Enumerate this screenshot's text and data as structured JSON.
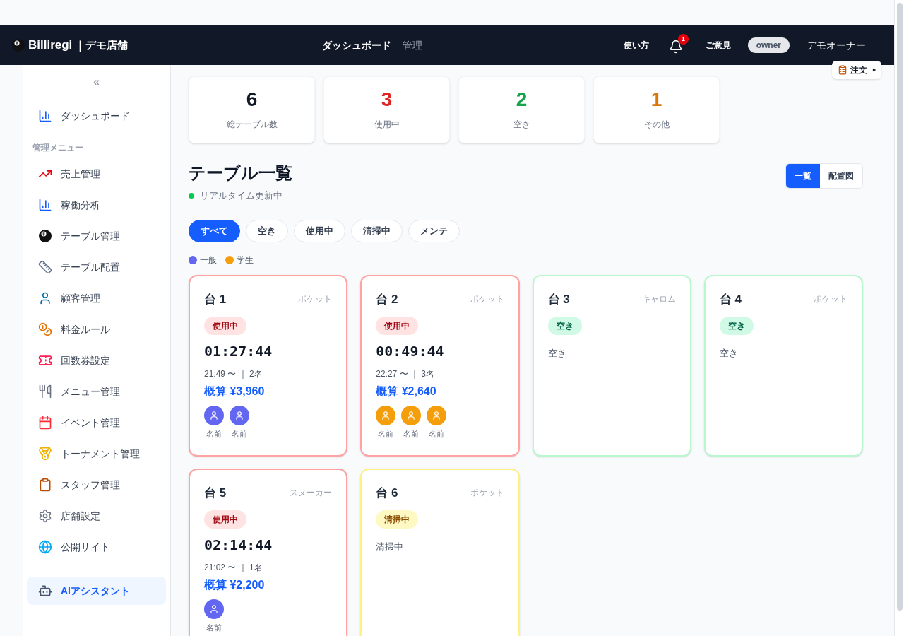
{
  "header": {
    "brand": "Billiregi",
    "store": "｜デモ店舗",
    "nav": [
      {
        "label": "ダッシュボード",
        "selected": true
      },
      {
        "label": "管理",
        "selected": false
      }
    ],
    "help": "使い方",
    "notifications": "1",
    "feedback": "ご意見",
    "role": "owner",
    "user": "デモオーナー",
    "order_button": "注文",
    "order_caret": "▸"
  },
  "sidebar": {
    "collapse": "«",
    "top_items": [
      {
        "label": "ダッシュボード",
        "selected": false
      }
    ],
    "section_title": "管理メニュー",
    "items": [
      {
        "label": "売上管理",
        "selected": false
      },
      {
        "label": "稼働分析",
        "selected": false
      },
      {
        "label": "テーブル管理",
        "selected": false
      },
      {
        "label": "テーブル配置",
        "selected": false
      },
      {
        "label": "顧客管理",
        "selected": false
      },
      {
        "label": "料金ルール",
        "selected": false
      },
      {
        "label": "回数券設定",
        "selected": false
      },
      {
        "label": "メニュー管理",
        "selected": false
      },
      {
        "label": "イベント管理",
        "selected": false
      },
      {
        "label": "トーナメント管理",
        "selected": false
      },
      {
        "label": "スタッフ管理",
        "selected": false
      },
      {
        "label": "店舗設定",
        "selected": false
      },
      {
        "label": "公開サイト",
        "selected": false
      }
    ],
    "assistant": {
      "label": "AIアシスタント",
      "selected": true
    }
  },
  "stats": [
    {
      "value": "6",
      "label": "総テーブル数",
      "color": "#111827"
    },
    {
      "value": "3",
      "label": "使用中",
      "color": "#dc2626"
    },
    {
      "value": "2",
      "label": "空き",
      "color": "#16a34a"
    },
    {
      "value": "1",
      "label": "その他",
      "color": "#d97706"
    }
  ],
  "title": "テーブル一覧",
  "live_status": "リアルタイム更新中",
  "view_toggle": [
    {
      "label": "一覧",
      "selected": true
    },
    {
      "label": "配置図",
      "selected": false
    }
  ],
  "filters": [
    {
      "label": "すべて",
      "selected": true
    },
    {
      "label": "空き",
      "selected": false
    },
    {
      "label": "使用中",
      "selected": false
    },
    {
      "label": "清掃中",
      "selected": false
    },
    {
      "label": "メンテ",
      "selected": false
    }
  ],
  "legend": [
    {
      "label": "一般",
      "color": "#6366f1"
    },
    {
      "label": "学生",
      "color": "#f59e0b"
    }
  ],
  "tables": [
    {
      "name": "台 1",
      "type": "ポケット",
      "status": "使用中",
      "kind": "in_use",
      "timer": "01:27:44",
      "since": "21:49 〜 ｜ 2名",
      "estimate": "概算 ¥3,960",
      "guests": [
        {
          "name": "名前",
          "color": "#6366f1"
        },
        {
          "name": "名前",
          "color": "#6366f1"
        }
      ]
    },
    {
      "name": "台 2",
      "type": "ポケット",
      "status": "使用中",
      "kind": "in_use",
      "timer": "00:49:44",
      "since": "22:27 〜 ｜ 3名",
      "estimate": "概算 ¥2,640",
      "guests": [
        {
          "name": "名前",
          "color": "#f59e0b"
        },
        {
          "name": "名前",
          "color": "#f59e0b"
        },
        {
          "name": "名前",
          "color": "#f59e0b"
        }
      ]
    },
    {
      "name": "台 3",
      "type": "キャロム",
      "status": "空き",
      "kind": "vacant",
      "note": "空き"
    },
    {
      "name": "台 4",
      "type": "ポケット",
      "status": "空き",
      "kind": "vacant",
      "note": "空き"
    },
    {
      "name": "台 5",
      "type": "スヌーカー",
      "status": "使用中",
      "kind": "in_use",
      "timer": "02:14:44",
      "since": "21:02 〜 ｜ 1名",
      "estimate": "概算 ¥2,200",
      "guests": [
        {
          "name": "名前",
          "color": "#6366f1"
        }
      ]
    },
    {
      "name": "台 6",
      "type": "ポケット",
      "status": "清掃中",
      "kind": "cleaning",
      "note": "清掃中"
    }
  ]
}
